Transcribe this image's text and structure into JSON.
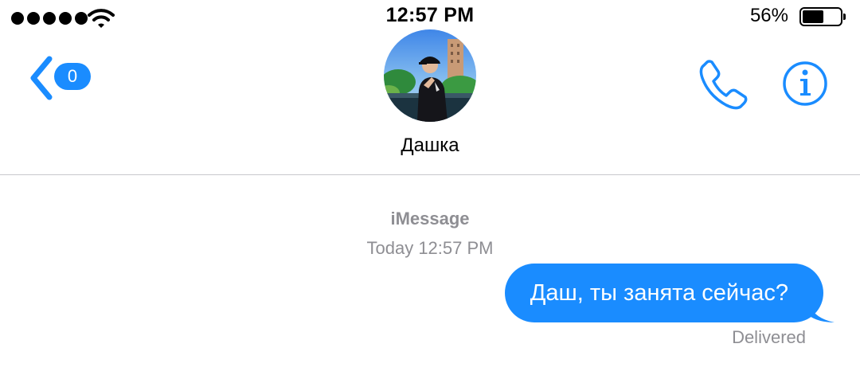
{
  "status_bar": {
    "signal_bars": 5,
    "signal_bars_filled": 5,
    "wifi_icon": "wifi-icon",
    "time": "12:57 PM",
    "battery_percent": "56%",
    "battery_level": 0.56
  },
  "nav": {
    "back_icon": "chevron-left-icon",
    "back_badge": "0",
    "contact_name": "Дашка",
    "avatar_icon": "contact-photo",
    "call_icon": "phone-icon",
    "info_icon": "info-icon",
    "accent_color": "#1a8cff"
  },
  "conversation": {
    "service": "iMessage",
    "timestamp": "Today 12:57 PM",
    "messages": [
      {
        "direction": "outgoing",
        "text": "Даш, ты занята сейчас?",
        "status": "Delivered",
        "bubble_color": "#1a8cff"
      }
    ]
  }
}
